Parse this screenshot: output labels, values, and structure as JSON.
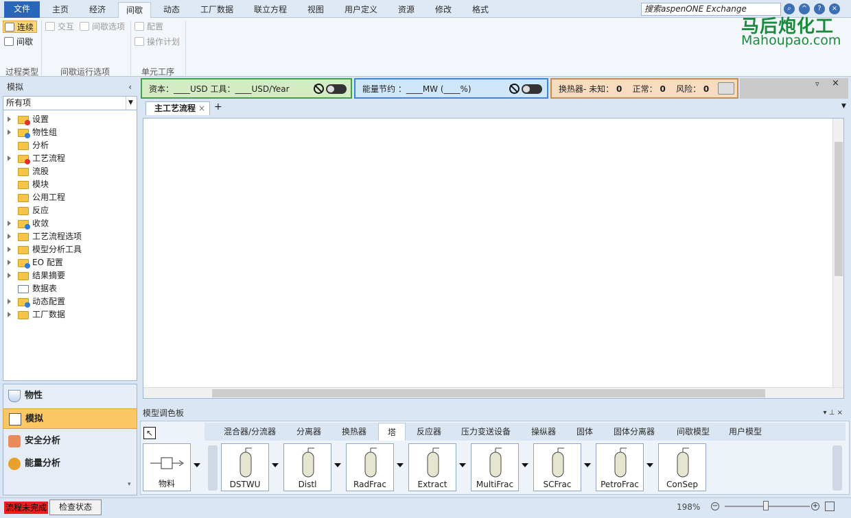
{
  "ribbon_tabs": [
    "文件",
    "主页",
    "经济",
    "间歇",
    "动态",
    "工厂数据",
    "联立方程",
    "视图",
    "用户定义",
    "资源",
    "修改",
    "格式"
  ],
  "search_placeholder": "搜索aspenONE Exchange",
  "ribbon": {
    "continuous": "连续",
    "batch": "间歇",
    "group1": "过程类型",
    "interactive": "交互",
    "batch_options": "间歇选项",
    "group2": "间歇运行选项",
    "config": "配置",
    "op_plan": "操作计划",
    "group3": "单元工序"
  },
  "nav": {
    "header": "模拟",
    "filter": "所有项",
    "tree": [
      {
        "label": "设置",
        "exp": true,
        "badge": "red"
      },
      {
        "label": "物性组",
        "exp": true,
        "badge": "blue"
      },
      {
        "label": "分析",
        "exp": false,
        "badge": ""
      },
      {
        "label": "工艺流程",
        "exp": true,
        "badge": "red"
      },
      {
        "label": "流股",
        "exp": false,
        "badge": ""
      },
      {
        "label": "模块",
        "exp": false,
        "badge": ""
      },
      {
        "label": "公用工程",
        "exp": false,
        "badge": ""
      },
      {
        "label": "反应",
        "exp": false,
        "badge": ""
      },
      {
        "label": "收敛",
        "exp": true,
        "badge": "blue"
      },
      {
        "label": "工艺流程选项",
        "exp": true,
        "badge": ""
      },
      {
        "label": "模型分析工具",
        "exp": true,
        "badge": ""
      },
      {
        "label": "EO 配置",
        "exp": true,
        "badge": "blue"
      },
      {
        "label": "结果摘要",
        "exp": true,
        "badge": ""
      },
      {
        "label": "数据表",
        "exp": false,
        "badge": "sheet"
      },
      {
        "label": "动态配置",
        "exp": true,
        "badge": "blue"
      },
      {
        "label": "工厂数据",
        "exp": true,
        "badge": ""
      }
    ],
    "bottom": [
      "物性",
      "模拟",
      "安全分析",
      "能量分析"
    ]
  },
  "indicators": {
    "capital": "资本：____USD   工具：____USD/Year",
    "energy": "能量节约 ：____MW    (____%)",
    "hx_label": "换热器- 未知：",
    "hx_unknown": "0",
    "hx_ok_label": "正常：",
    "hx_ok": "0",
    "hx_risk_label": "风险：",
    "hx_risk": "0"
  },
  "doc_tab": "主工艺流程",
  "palette": {
    "title": "模型调色板",
    "tabs": [
      "混合器/分流器",
      "分离器",
      "换热器",
      "塔",
      "反应器",
      "压力变送设备",
      "操纵器",
      "固体",
      "固体分离器",
      "间歇模型",
      "用户模型"
    ],
    "active_tab": "塔",
    "stream": "物料",
    "items": [
      "DSTWU",
      "Distl",
      "RadFrac",
      "Extract",
      "MultiFrac",
      "SCFrac",
      "PetroFrac",
      "ConSep"
    ]
  },
  "status": {
    "warning": "流程未完成",
    "check": "检查状态",
    "zoom": "198%"
  },
  "watermark": {
    "cn": "马后炮化工",
    "en": "Mahoupao.com"
  },
  "colors": {
    "capital_bg": "#d4ecc4",
    "capital_border": "#3fa33f",
    "energy_bg": "#cfe6fb",
    "energy_border": "#3a86e0",
    "hx_bg": "#f7dcc0",
    "hx_border": "#c98d4d",
    "active_nav": "#fcc865",
    "status_red": "#e82020"
  }
}
